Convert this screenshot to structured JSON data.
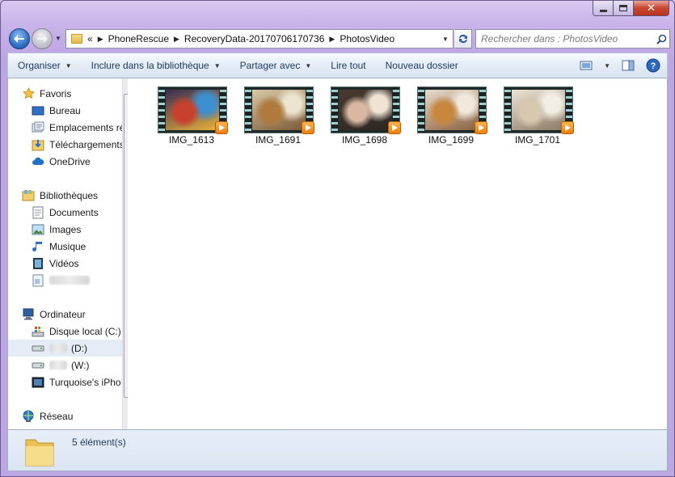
{
  "window": {
    "close_glyph": "✕"
  },
  "navigation": {
    "back_icon": "arrow-left-icon",
    "forward_icon": "arrow-right-icon",
    "breadcrumb_overflow": "«",
    "breadcrumbs": [
      "PhoneRescue",
      "RecoveryData-20170706170736",
      "PhotosVideo"
    ]
  },
  "search": {
    "placeholder": "Rechercher dans : PhotosVideo"
  },
  "toolbar": {
    "organize": "Organiser",
    "include_library": "Inclure dans la bibliothèque",
    "share": "Partager avec",
    "play_all": "Lire tout",
    "new_folder": "Nouveau dossier"
  },
  "sidebar": {
    "favorites": {
      "header": "Favoris",
      "items": [
        "Bureau",
        "Emplacements ré",
        "Téléchargements",
        "OneDrive"
      ]
    },
    "libraries": {
      "header": "Bibliothèques",
      "items": [
        "Documents",
        "Images",
        "Musique",
        "Vidéos"
      ]
    },
    "computer": {
      "header": "Ordinateur",
      "local_disk": "Disque local (C:)",
      "drive_d": "(D:)",
      "drive_w": "(W:)",
      "iphone": "Turquoise's iPho"
    },
    "network": {
      "header": "Réseau"
    }
  },
  "files": [
    {
      "name": "IMG_1613",
      "palette": [
        "#3a2a55",
        "#c8402e",
        "#3c8fd1",
        "#e8b23a"
      ]
    },
    {
      "name": "IMG_1691",
      "palette": [
        "#d8c9a6",
        "#b07a3c",
        "#ece4cf",
        "#7b5a36"
      ]
    },
    {
      "name": "IMG_1698",
      "palette": [
        "#4a3a30",
        "#d9b7a2",
        "#efe3d4",
        "#2b2622"
      ]
    },
    {
      "name": "IMG_1699",
      "palette": [
        "#e6dccb",
        "#c9873e",
        "#f0e9dc",
        "#8a6040"
      ]
    },
    {
      "name": "IMG_1701",
      "palette": [
        "#ece4d4",
        "#d7c8b0",
        "#f3eee4",
        "#8c7a66"
      ]
    }
  ],
  "status": {
    "count_text": "5 élément(s)"
  },
  "colors": {
    "accent": "#1e395b",
    "window_frame": "#c8b3ea",
    "selected_row": "#e6ecf5"
  }
}
